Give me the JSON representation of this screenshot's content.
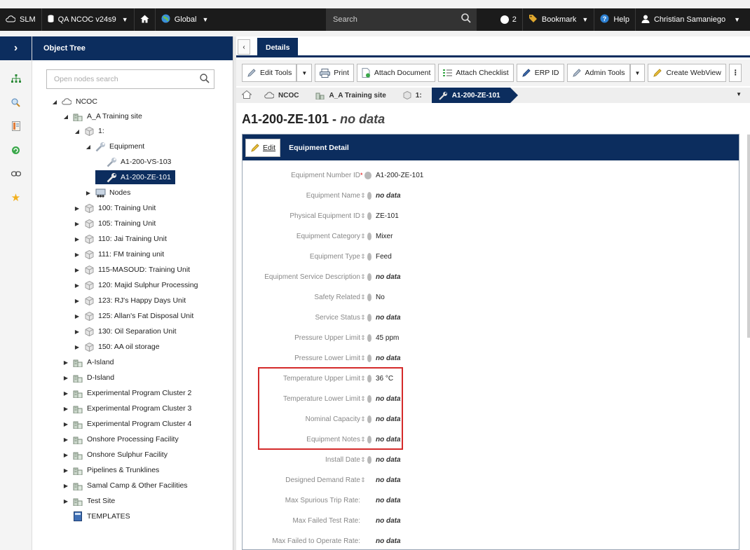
{
  "topbar": {
    "app": "SLM",
    "database": "QA NCOC v24s9",
    "scope": "Global",
    "search_placeholder": "Search",
    "notification_count": "2",
    "bookmark": "Bookmark",
    "help": "Help",
    "user": "Christian Samaniego"
  },
  "tree": {
    "header": "Object Tree",
    "search_placeholder": "Open nodes search",
    "nodes": [
      {
        "label": "NCOC"
      },
      {
        "label": "A_A Training site"
      },
      {
        "label": "1:"
      },
      {
        "label": "Equipment"
      },
      {
        "label": "A1-200-VS-103"
      },
      {
        "label": "A1-200-ZE-101"
      },
      {
        "label": "Nodes"
      },
      {
        "label": "100: Training Unit"
      },
      {
        "label": "105: Training Unit"
      },
      {
        "label": "110: Jai Training Unit"
      },
      {
        "label": "111: FM training unit"
      },
      {
        "label": "115-MASOUD: Training Unit"
      },
      {
        "label": "120: Majid Sulphur Processing"
      },
      {
        "label": "123: RJ's Happy Days Unit"
      },
      {
        "label": "125: Allan's Fat Disposal Unit"
      },
      {
        "label": "130: Oil Separation Unit"
      },
      {
        "label": "150: AA oil storage"
      },
      {
        "label": "A-Island"
      },
      {
        "label": "D-Island"
      },
      {
        "label": "Experimental Program Cluster 2"
      },
      {
        "label": "Experimental Program Cluster 3"
      },
      {
        "label": "Experimental Program Cluster 4"
      },
      {
        "label": "Onshore Processing Facility"
      },
      {
        "label": "Onshore Sulphur Facility"
      },
      {
        "label": "Pipelines & Trunklines"
      },
      {
        "label": "Samal Camp & Other Facilities"
      },
      {
        "label": "Test Site"
      },
      {
        "label": "TEMPLATES"
      }
    ]
  },
  "tab": {
    "label": "Details"
  },
  "toolbar": {
    "edit_tools": "Edit Tools",
    "print": "Print",
    "attach_document": "Attach Document",
    "attach_checklist": "Attach Checklist",
    "erp_id": "ERP ID",
    "admin_tools": "Admin Tools",
    "create_webview": "Create WebView"
  },
  "breadcrumb": {
    "items": [
      "NCOC",
      "A_A Training site",
      "1:",
      "A1-200-ZE-101"
    ]
  },
  "page": {
    "title": "A1-200-ZE-101 -",
    "title_suffix": "no data"
  },
  "card": {
    "edit_label": "Edit",
    "title": "Equipment Detail",
    "fields": [
      {
        "label": "Equipment Number ID",
        "value": "A1-200-ZE-101"
      },
      {
        "label": "Equipment Name",
        "value": "no data"
      },
      {
        "label": "Physical Equipment ID",
        "value": "ZE-101"
      },
      {
        "label": "Equipment Category",
        "value": "Mixer"
      },
      {
        "label": "Equipment Type",
        "value": "Feed"
      },
      {
        "label": "Equipment Service Description",
        "value": "no data"
      },
      {
        "label": "Safety Related",
        "value": "No"
      },
      {
        "label": "Service Status",
        "value": "no data"
      },
      {
        "label": "Pressure Upper Limit",
        "value": "45 ppm"
      },
      {
        "label": "Pressure Lower Limit",
        "value": "no data"
      },
      {
        "label": "Temperature Upper Limit",
        "value": "36 °C"
      },
      {
        "label": "Temperature Lower Limit",
        "value": "no data"
      },
      {
        "label": "Nominal Capacity",
        "value": "no data"
      },
      {
        "label": "Equipment Notes",
        "value": "no data"
      },
      {
        "label": "Install Date",
        "value": "no data"
      },
      {
        "label": "Designed Demand Rate",
        "value": "no data"
      },
      {
        "label": "Max Spurious Trip Rate:",
        "value": "no data"
      },
      {
        "label": "Max Failed Test Rate:",
        "value": "no data"
      },
      {
        "label": "Max Failed to Operate Rate:",
        "value": "no data"
      }
    ]
  },
  "colors": {
    "navy": "#0c2d5e",
    "highlight": "#d42a2a"
  }
}
